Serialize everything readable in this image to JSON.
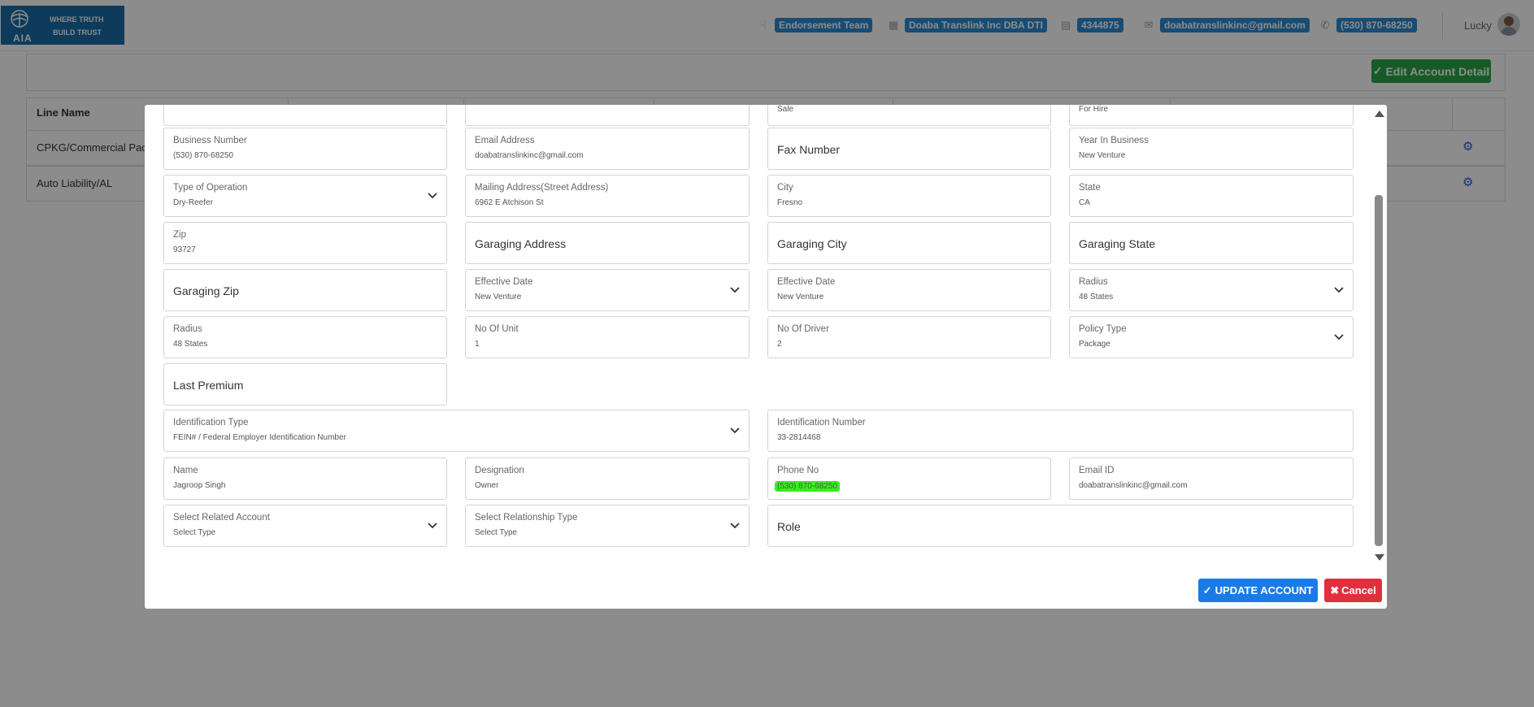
{
  "header": {
    "logo_abbr": "AIA",
    "tagline_1": "WHERE TRUTH",
    "tagline_2": "BUILD TRUST",
    "team_icon": "handshake-icon",
    "team": "Endorsement Team",
    "company_icon": "building-icon",
    "company": "Doaba Translink Inc DBA DTI",
    "id_icon": "document-icon",
    "account_id": "4344875",
    "email_icon": "envelope-icon",
    "email": "doabatranslinkinc@gmail.com",
    "phone_icon": "phone-icon",
    "phone": "(530) 870-68250",
    "user": "Lucky"
  },
  "background": {
    "edit_button": "Edit Account Detail",
    "column_line_name": "Line Name",
    "rows": [
      "CPKG/Commercial Pack",
      "Auto Liability/AL"
    ]
  },
  "modal": {
    "top_partial": {
      "sale": "Sale",
      "for_hire": "For Hire"
    },
    "fields": {
      "business_number": {
        "label": "Business Number",
        "value": "(530) 870-68250"
      },
      "email_address": {
        "label": "Email Address",
        "value": "doabatranslinkinc@gmail.com"
      },
      "fax_number": {
        "placeholder": "Fax Number"
      },
      "year_in_business": {
        "label": "Year In Business",
        "value": "New Venture"
      },
      "type_of_operation": {
        "label": "Type of Operation",
        "value": "Dry-Reefer"
      },
      "mailing_address": {
        "label": "Mailing Address(Street Address)",
        "value": "6962 E Atchison St"
      },
      "city": {
        "label": "City",
        "value": "Fresno"
      },
      "state": {
        "label": "State",
        "value": "CA"
      },
      "zip": {
        "label": "Zip",
        "value": "93727"
      },
      "garaging_address": {
        "placeholder": "Garaging Address"
      },
      "garaging_city": {
        "placeholder": "Garaging City"
      },
      "garaging_state": {
        "placeholder": "Garaging State"
      },
      "garaging_zip": {
        "placeholder": "Garaging Zip"
      },
      "effective_date_1": {
        "label": "Effective Date",
        "value": "New Venture"
      },
      "effective_date_2": {
        "label": "Effective Date",
        "value": "New Venture"
      },
      "radius_1": {
        "label": "Radius",
        "value": "48 States"
      },
      "radius_2": {
        "label": "Radius",
        "value": "48 States"
      },
      "no_of_unit": {
        "label": "No Of Unit",
        "value": "1"
      },
      "no_of_driver": {
        "label": "No Of Driver",
        "value": "2"
      },
      "policy_type": {
        "label": "Policy Type",
        "value": "Package"
      },
      "last_premium": {
        "placeholder": "Last Premium"
      },
      "identification_type": {
        "label": "Identification Type",
        "value": "FEIN# / Federal Employer Identification Number"
      },
      "identification_number": {
        "label": "Identification Number",
        "value": "33-2814468"
      },
      "name": {
        "label": "Name",
        "value": "Jagroop Singh"
      },
      "designation": {
        "label": "Designation",
        "value": "Owner"
      },
      "phone_no": {
        "label": "Phone No",
        "value": "(530) 870-68250"
      },
      "email_id": {
        "label": "Email ID",
        "value": "doabatranslinkinc@gmail.com"
      },
      "related_account": {
        "label": "Select Related Account",
        "value": "Select Type"
      },
      "relationship_type": {
        "label": "Select Relationship Type",
        "value": "Select Type"
      },
      "role": {
        "placeholder": "Role"
      }
    },
    "update_button": "UPDATE ACCOUNT",
    "cancel_button": "Cancel"
  },
  "colors": {
    "brand_blue": "#1a6ca8",
    "badge_blue": "#2a8bd3",
    "success_green": "#28a745",
    "primary_blue": "#1a7be8",
    "danger_red": "#e0303e",
    "highlight_green": "#35f01a"
  }
}
